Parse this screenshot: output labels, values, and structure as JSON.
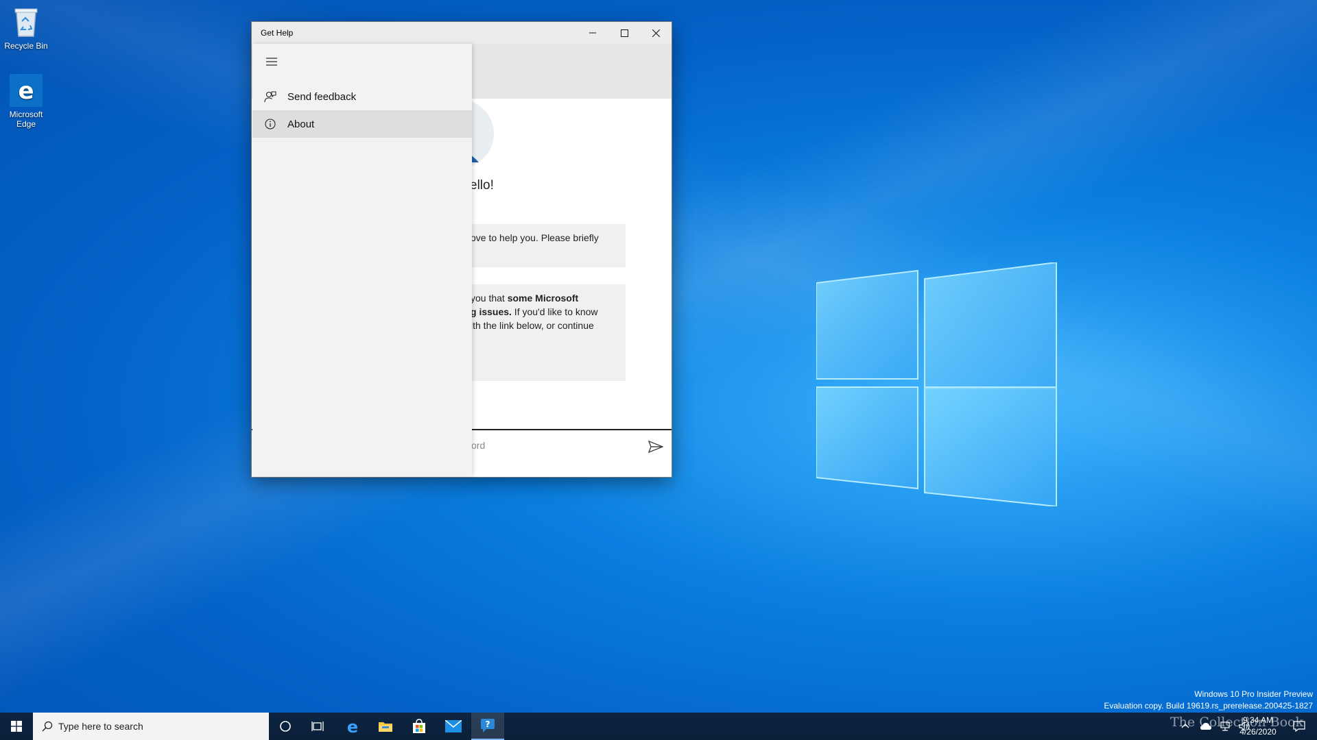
{
  "desktop": {
    "icons": [
      {
        "label": "Recycle Bin"
      },
      {
        "label": "Microsoft Edge"
      }
    ]
  },
  "window": {
    "title": "Get Help",
    "controls": {
      "minimize": "minimize",
      "maximize": "maximize",
      "close": "close"
    }
  },
  "chat": {
    "greeting": "ello!",
    "bubble1_line1": "ove to help you. Please briefly",
    "bubble2_line1_a": "you that ",
    "bubble2_line1_b": "some Microsoft",
    "bubble2_line2_a": "g issues.",
    "bubble2_line2_b": " If you'd like to know",
    "bubble2_line3": "ith the link below, or continue",
    "input_placeholder": "ord"
  },
  "nav": {
    "items": [
      {
        "label": "Send feedback",
        "icon": "feedback-icon"
      },
      {
        "label": "About",
        "icon": "info-icon",
        "selected": true
      }
    ]
  },
  "taskbar": {
    "search_placeholder": "Type here to search",
    "time": "9:34 AM",
    "date": "4/26/2020"
  },
  "watermark": {
    "line1": "Windows 10 Pro Insider Preview",
    "line2": "Evaluation copy. Build 19619.rs_prerelease.200425-1827"
  },
  "brand": "The Collection Book",
  "colors": {
    "accent": "#0078d7",
    "taskbar": "#0b1f38",
    "nav_bg": "#f2f2f2"
  }
}
